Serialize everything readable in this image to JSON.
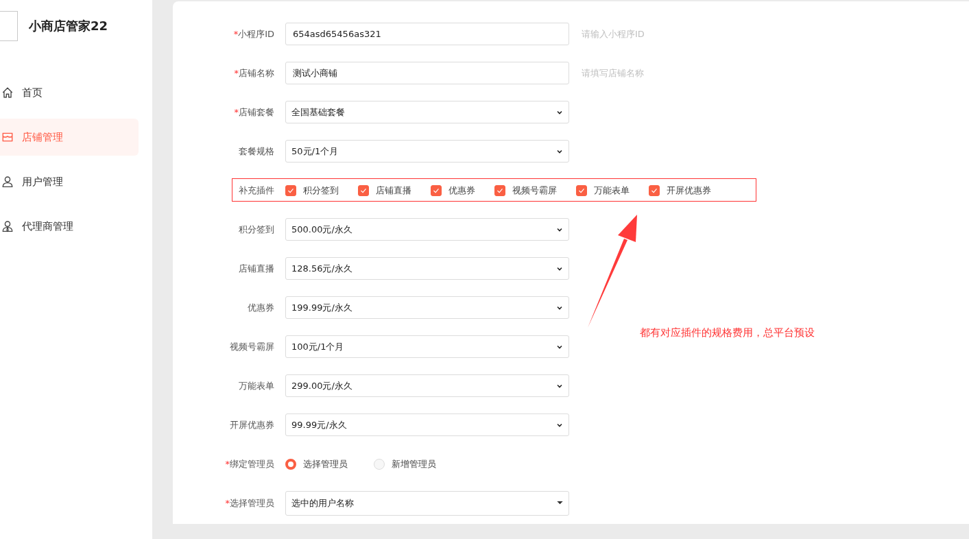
{
  "sidebar": {
    "title": "小商店管家22",
    "items": [
      {
        "label": "首页",
        "selected": false
      },
      {
        "label": "店铺管理",
        "selected": true
      },
      {
        "label": "用户管理",
        "selected": false
      },
      {
        "label": "代理商管理",
        "selected": false
      }
    ]
  },
  "form": {
    "rows": [
      {
        "kind": "input",
        "label": "小程序ID",
        "marker": "*",
        "value": "654asd65456as321",
        "hint": "请输入小程序ID"
      },
      {
        "kind": "input",
        "label": "店铺名称",
        "marker": "*",
        "value": "测试小商铺",
        "hint": "请填写店铺名称"
      },
      {
        "kind": "select",
        "label": "店铺套餐",
        "marker": "*",
        "value": "全国基础套餐"
      },
      {
        "kind": "select",
        "label": "套餐规格",
        "value": "50元/1个月"
      },
      {
        "kind": "checkboxes",
        "label": "补充插件",
        "options": [
          {
            "label": "积分签到",
            "checked": true
          },
          {
            "label": "店铺直播",
            "checked": true
          },
          {
            "label": "优惠券",
            "checked": true
          },
          {
            "label": "视频号霸屏",
            "checked": true
          },
          {
            "label": "万能表单",
            "checked": true
          },
          {
            "label": "开屏优惠券",
            "checked": true
          }
        ]
      },
      {
        "kind": "select",
        "label": "积分签到",
        "value": "500.00元/永久"
      },
      {
        "kind": "select",
        "label": "店铺直播",
        "value": "128.56元/永久"
      },
      {
        "kind": "select",
        "label": "优惠券",
        "value": "199.99元/永久"
      },
      {
        "kind": "select",
        "label": "视频号霸屏",
        "value": "100元/1个月"
      },
      {
        "kind": "select",
        "label": "万能表单",
        "value": "299.00元/永久"
      },
      {
        "kind": "select",
        "label": "开屏优惠券",
        "value": "99.99元/永久"
      },
      {
        "kind": "radios",
        "label": "绑定管理员",
        "marker": "*",
        "options": [
          {
            "label": "选择管理员",
            "selected": true
          },
          {
            "label": "新增管理员",
            "selected": false
          }
        ]
      },
      {
        "kind": "dropdown",
        "label": "选择管理员",
        "marker": "*",
        "value": "选中的用户名称"
      }
    ]
  },
  "annotation": {
    "text": "都有对应插件的规格费用，总平台预设"
  }
}
